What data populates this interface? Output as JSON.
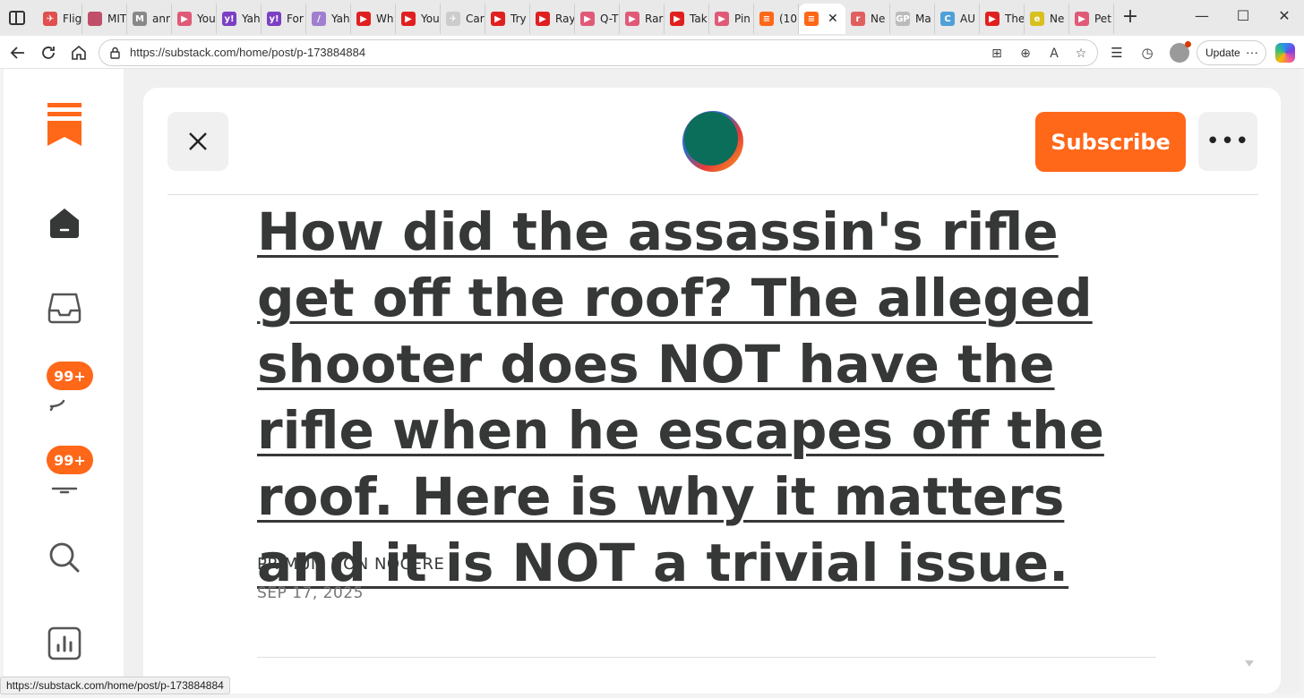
{
  "browser": {
    "tabs": [
      {
        "label": "Flig",
        "fav_color": "#e05050",
        "glyph": "✈"
      },
      {
        "label": "MIT",
        "fav_color": "#c0506a",
        "glyph": ""
      },
      {
        "label": "anr",
        "fav_color": "#888888",
        "glyph": "M"
      },
      {
        "label": "You",
        "fav_color": "#e05a78",
        "glyph": "▶"
      },
      {
        "label": "Yah",
        "fav_color": "#7b3fc4",
        "glyph": "y!"
      },
      {
        "label": "For",
        "fav_color": "#7b3fc4",
        "glyph": "y!"
      },
      {
        "label": "Yah",
        "fav_color": "#a07fd0",
        "glyph": "/"
      },
      {
        "label": "Wh",
        "fav_color": "#e02020",
        "glyph": "▶"
      },
      {
        "label": "You",
        "fav_color": "#e02020",
        "glyph": "▶"
      },
      {
        "label": "Car",
        "fav_color": "#cccccc",
        "glyph": "✈"
      },
      {
        "label": "Try",
        "fav_color": "#e02020",
        "glyph": "▶"
      },
      {
        "label": "Ray",
        "fav_color": "#e02020",
        "glyph": "▶"
      },
      {
        "label": "Q-T",
        "fav_color": "#e05a78",
        "glyph": "▶"
      },
      {
        "label": "Rar",
        "fav_color": "#e05a78",
        "glyph": "▶"
      },
      {
        "label": "Tak",
        "fav_color": "#e02020",
        "glyph": "▶"
      },
      {
        "label": "Pin",
        "fav_color": "#e05a78",
        "glyph": "▶"
      },
      {
        "label": "(10",
        "fav_color": "#ff6719",
        "glyph": "≡"
      }
    ],
    "active_tab": {
      "label": "",
      "fav_color": "#ff6719",
      "glyph": "≡",
      "close": "✕"
    },
    "tabs_after": [
      {
        "label": "Ne",
        "fav_color": "#e06060",
        "glyph": "r"
      },
      {
        "label": "Ma",
        "fav_color": "#bbbbbb",
        "glyph": "GP"
      },
      {
        "label": "AU",
        "fav_color": "#4fa0d8",
        "glyph": "C"
      },
      {
        "label": "The",
        "fav_color": "#e02020",
        "glyph": "▶"
      },
      {
        "label": "Ne",
        "fav_color": "#d8c020",
        "glyph": "e"
      },
      {
        "label": "Pet",
        "fav_color": "#e05a78",
        "glyph": "▶"
      }
    ],
    "new_tab": "+",
    "window_controls": {
      "minimize": "—",
      "maximize": "☐",
      "close": "✕"
    },
    "url": "https://substack.com/home/post/p-173884884",
    "update_label": "Update",
    "update_more": "···",
    "status_url": "https://substack.com/home/post/p-173884884"
  },
  "sidebar": {
    "badges": {
      "chat": "99+",
      "notifications": "99+"
    },
    "brand_color": "#ff6719"
  },
  "post": {
    "subscribe_label": "Subscribe",
    "more_label": "•••",
    "title": "How did the assassin's rifle get off the roof? The alleged shooter does NOT have the rifle when he escapes off the roof. Here is why it matters and it is NOT a trivial issue.",
    "author": "PRIMUM NON NOCERE",
    "date": "SEP 17, 2025"
  }
}
